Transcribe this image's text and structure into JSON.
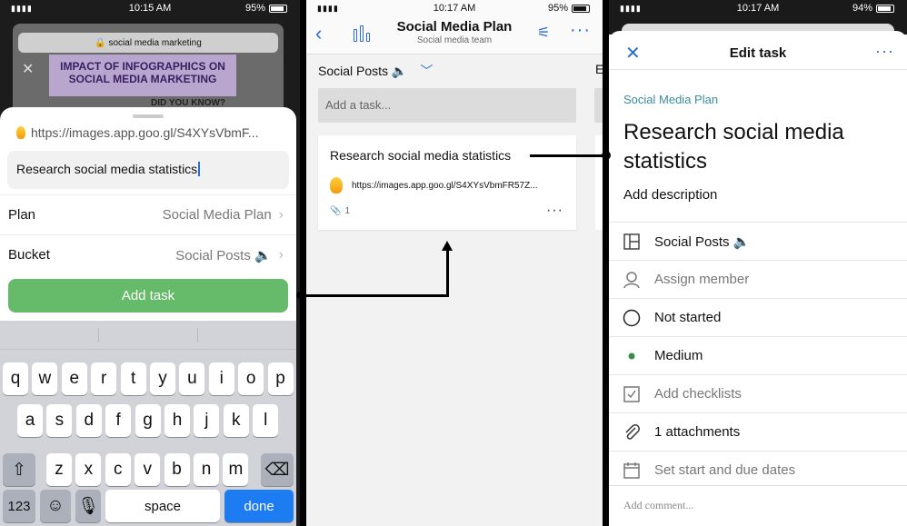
{
  "panel1": {
    "status": {
      "time": "10:15 AM",
      "battery": "95%"
    },
    "browser": {
      "url": "social media marketing",
      "banner": "IMPACT OF INFOGRAPHICS ON SOCIAL MEDIA MARKETING",
      "did_you_know": "DID YOU KNOW?"
    },
    "link": "https://images.app.goo.gl/S4XYsVbmF...",
    "task_input": "Research social media statistics",
    "plan_label": "Plan",
    "plan_value": "Social Media Plan",
    "bucket_label": "Bucket",
    "bucket_value": "Social Posts 🔈",
    "add_button": "Add task",
    "keyboard": {
      "row1": [
        "q",
        "w",
        "e",
        "r",
        "t",
        "y",
        "u",
        "i",
        "o",
        "p"
      ],
      "row2": [
        "a",
        "s",
        "d",
        "f",
        "g",
        "h",
        "j",
        "k",
        "l"
      ],
      "row3": [
        "z",
        "x",
        "c",
        "v",
        "b",
        "n",
        "m"
      ],
      "num": "123",
      "space": "space",
      "done": "done"
    }
  },
  "panel2": {
    "status": {
      "time": "10:17 AM",
      "battery": "95%"
    },
    "title": "Social Media Plan",
    "subtitle": "Social media team",
    "bucket": "Social Posts 🔈",
    "next_bucket_initial": "E",
    "add_task_placeholder": "Add a task...",
    "card": {
      "title": "Research social media statistics",
      "link": "https://images.app.goo.gl/S4XYsVbmFR57Z...",
      "attachments": "1"
    }
  },
  "panel3": {
    "status": {
      "time": "10:17 AM",
      "battery": "94%"
    },
    "header": "Edit task",
    "plan": "Social Media Plan",
    "title": "Research social media statistics",
    "description": "Add description",
    "rows": {
      "bucket": "Social Posts 🔈",
      "assign": "Assign member",
      "progress": "Not started",
      "priority": "Medium",
      "checklist": "Add checklists",
      "attachments": "1 attachments",
      "dates": "Set start and due dates"
    },
    "comment_placeholder": "Add comment..."
  },
  "colors": {
    "accent": "#2a6bd6",
    "add_button": "#66bb6a",
    "plan_link": "#3a8c9e",
    "priority_dot": "#3c8a4a"
  }
}
